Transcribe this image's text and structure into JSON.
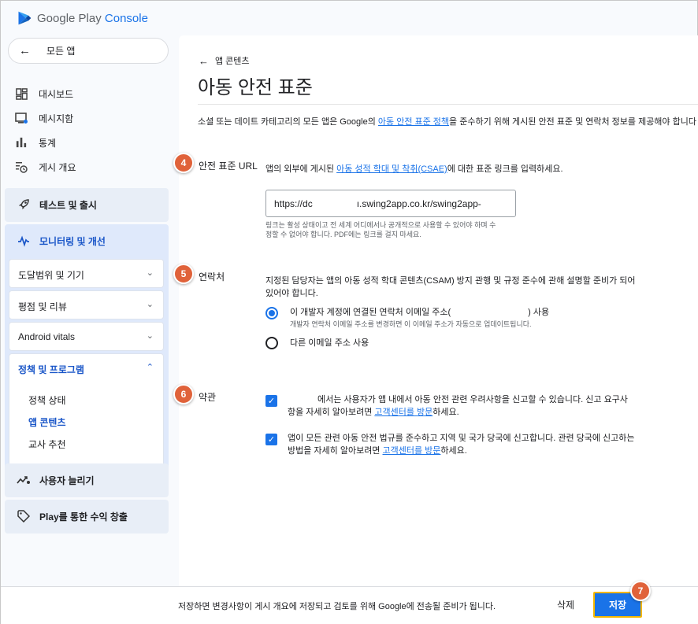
{
  "app": {
    "brand": "Google Play",
    "brand_suffix": "Console"
  },
  "sidebar": {
    "back_label": "모든 앱",
    "items": [
      {
        "label": "대시보드",
        "icon": "dashboard-icon"
      },
      {
        "label": "메시지함",
        "icon": "inbox-icon"
      },
      {
        "label": "통계",
        "icon": "bar-chart-icon"
      },
      {
        "label": "게시 개요",
        "icon": "publishing-overview-icon"
      }
    ],
    "test_release": "테스트 및 출시",
    "monitor": {
      "label": "모니터링 및 개선",
      "subsections": [
        {
          "label": "도달범위 및 기기"
        },
        {
          "label": "평점 및 리뷰"
        },
        {
          "label": "Android vitals"
        },
        {
          "label": "정책 및 프로그램"
        }
      ],
      "policy_links": [
        "정책 상태",
        "앱 콘텐츠",
        "교사 추천"
      ]
    },
    "grow_users": "사용자 늘리기",
    "monetize": "Play를 통한 수익 창출"
  },
  "main": {
    "breadcrumb": "앱 콘텐츠",
    "title": "아동 안전 표준",
    "intro_prefix": "소셜 또는 데이트 카테고리의 모든 앱은 Google의 ",
    "intro_link": "아동 안전 표준 정책",
    "intro_suffix": "을 준수하기 위해 게시된 안전 표준 및 연락처 정보를 제공해야 합니다",
    "url_section": {
      "badge": "4",
      "label": "안전 표준 URL",
      "desc_prefix": "앱의 외부에 게시된 ",
      "desc_link": "아동 성적 학대 및 착취(CSAE)",
      "desc_suffix": "에 대한 표준 링크를 입력하세요.",
      "value_start": "https://dc",
      "value_end": "ı.swing2app.co.kr/swing2app-",
      "hint_line1": "링크는 활성 상태이고 전 세계 어디에서나 공개적으로 사용할 수 있어야 하며 수",
      "hint_line2": "정할 수 없어야 합니다. PDF에는 링크를 걸지 마세요."
    },
    "contact_section": {
      "badge": "5",
      "label": "연락처",
      "desc_line1": "지정된 담당자는 앱의 아동 성적 학대 콘텐츠(CSAM) 방지 관행 및 규정 준수에 관해 설명할 준비가 되어",
      "desc_line2": "있어야 합니다.",
      "option1_prefix": "이 개발자 계정에 연결된 연락처 이메일 주소(",
      "option1_suffix": ") 사용",
      "option1_hint": "개발자 연락처 이메일 주소를 변경하면 이 이메일 주소가 자동으로 업데이트됩니다.",
      "option2": "다른 이메일 주소 사용"
    },
    "terms_section": {
      "badge": "6",
      "label": "약관",
      "check1_line1": "에서는 사용자가 앱 내에서 아동 안전 관련 우려사항을 신고할 수 있습니다. 신고 요구사",
      "check1_line2_prefix": "항을 자세히 알아보려면 ",
      "check1_link": "고객센터를 방문",
      "check1_line2_suffix": "하세요.",
      "check2_line1": "앱이 모든 관련 아동 안전 법규를 준수하고 지역 및 국가 당국에 신고합니다. 관련 당국에 신고하는",
      "check2_line2_prefix": "방법을 자세히 알아보려면 ",
      "check2_link": "고객센터를 방문",
      "check2_line2_suffix": "하세요."
    }
  },
  "footer": {
    "message": "저장하면 변경사항이 게시 개요에 저장되고 검토를 위해 Google에 전송될 준비가 됩니다.",
    "delete": "삭제",
    "save": "저장",
    "save_badge": "7"
  },
  "colors": {
    "accent": "#1a73e8",
    "badge": "#e0623a",
    "highlight": "#f5b700"
  }
}
